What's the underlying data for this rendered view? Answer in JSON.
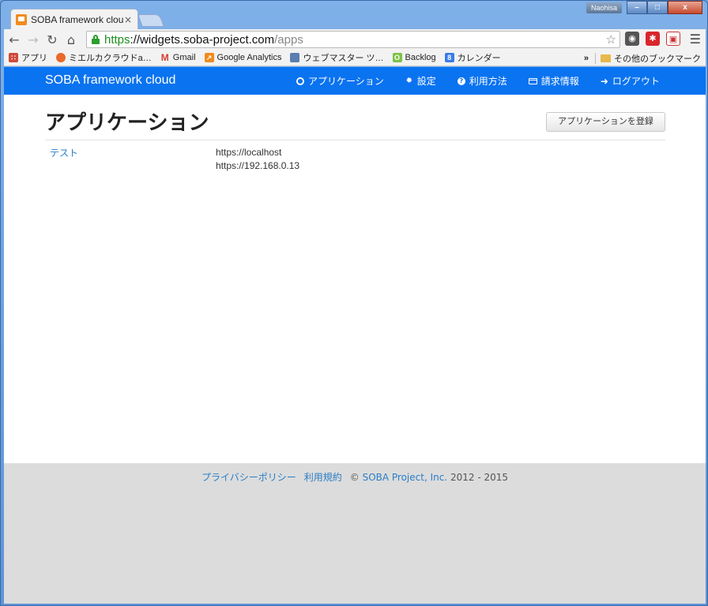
{
  "browser": {
    "tab_title": "SOBA framework cloud",
    "tab_close": "×",
    "profile_name": "Naohisa",
    "window_buttons": {
      "minimize": "–",
      "maximize": "□",
      "close": "x"
    },
    "url": {
      "scheme": "https",
      "separator": "://",
      "host": "widgets.soba-project.com",
      "path": "/apps"
    },
    "nav_icons": [
      "back-icon",
      "forward-icon",
      "reload-icon",
      "home-icon"
    ],
    "bookmarks": [
      {
        "label": "アプリ",
        "icon": "apps-grid-icon",
        "color": "#d04a3a"
      },
      {
        "label": "ミエルカクラウドa…",
        "icon": "mieruca-icon",
        "color": "#e8692a"
      },
      {
        "label": "Gmail",
        "icon": "gmail-icon",
        "color": "#d23f31"
      },
      {
        "label": "Google Analytics",
        "icon": "analytics-icon",
        "color": "#f08a1c"
      },
      {
        "label": "ウェブマスター ツ…",
        "icon": "webmaster-icon",
        "color": "#5a7fb0"
      },
      {
        "label": "Backlog",
        "icon": "backlog-icon",
        "color": "#7cc245"
      },
      {
        "label": "カレンダー",
        "icon": "calendar-icon",
        "color": "#3b7ae6"
      }
    ],
    "bookmarks_overflow": "»",
    "other_bookmarks": "その他のブックマーク"
  },
  "navbar": {
    "brand": "SOBA framework cloud",
    "items": [
      {
        "label": "アプリケーション",
        "icon": "globe-icon"
      },
      {
        "label": "設定",
        "icon": "gear-icon"
      },
      {
        "label": "利用方法",
        "icon": "question-icon"
      },
      {
        "label": "請求情報",
        "icon": "credit-card-icon"
      },
      {
        "label": "ログアウト",
        "icon": "logout-arrow-icon"
      }
    ]
  },
  "main": {
    "title": "アプリケーション",
    "register_button": "アプリケーションを登録",
    "apps": [
      {
        "name": "テスト",
        "origins": [
          "https://localhost",
          "https://192.168.0.13"
        ]
      }
    ]
  },
  "footer": {
    "privacy": "プライバシーポリシー",
    "terms": "利用規約",
    "copyright_symbol": "©",
    "company": "SOBA Project, Inc.",
    "years": "2012 - 2015"
  },
  "colors": {
    "navbar": "#0a73f0",
    "link": "#2a7ec6",
    "footer_bg": "#dcdcdc",
    "secure_green": "#1b8f1b"
  }
}
